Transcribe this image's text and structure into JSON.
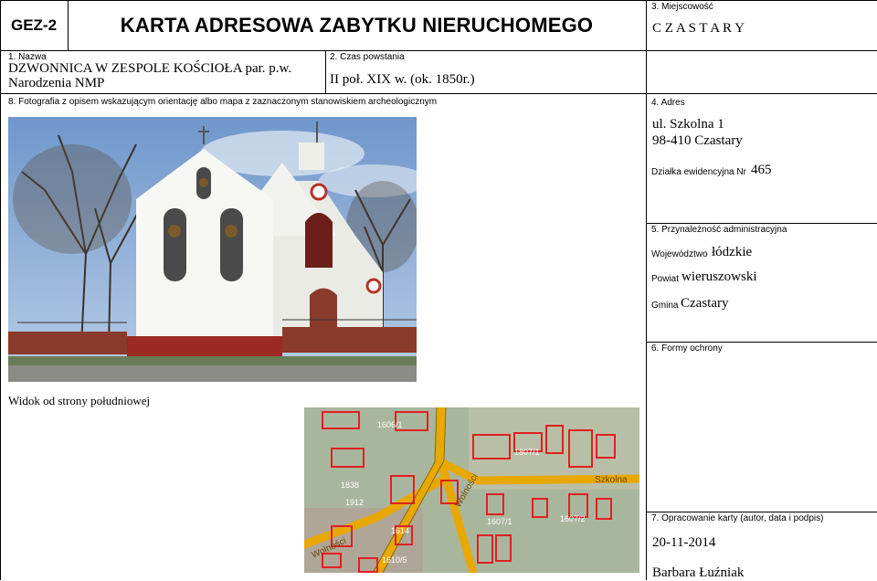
{
  "header": {
    "code": "GEZ-2",
    "title": "KARTA ADRESOWA ZABYTKU NIERUCHOMEGO"
  },
  "fields": {
    "nazwa": {
      "label": "1. Nazwa",
      "line1": "DZWONNICA W ZESPOLE KOŚCIOŁA par. p.w.",
      "line2": "Narodzenia NMP"
    },
    "czas": {
      "label": "2. Czas powstania",
      "value": "II poł. XIX w. (ok. 1850r.)"
    },
    "miejscowosc": {
      "label": "3. Miejscowość",
      "value": "C Z A S T A R Y"
    },
    "adres": {
      "label": "4. Adres",
      "street": "ul. Szkolna 1",
      "city": "98-410 Czastary",
      "dzialka_label": "Działka ewidencyjna Nr",
      "dzialka_value": "465"
    },
    "przynaleznosc": {
      "label": "5. Przynależność administracyjna",
      "woj_label": "Województwo",
      "woj_value": "łódzkie",
      "pow_label": "Powiat",
      "pow_value": "wieruszowski",
      "gmina_label": "Gmina",
      "gmina_value": "Czastary"
    },
    "formy": {
      "label": "6. Formy ochrony"
    },
    "opracowanie": {
      "label": "7. Opracowanie karty (autor, data i podpis)",
      "date": "20-11-2014",
      "author": "Barbara Łuźniak"
    },
    "foto": {
      "label": "8. Fotografia z opisem wskazującym orientację albo mapa z zaznaczonym stanowiskiem archeologicznym",
      "caption": "Widok od strony południowej"
    }
  },
  "map": {
    "street_labels": [
      "Wolności",
      "Szkolna",
      "Wolności"
    ],
    "parcel_labels": [
      "1606/1",
      "1807/1",
      "1912",
      "1607/1",
      "1607/2",
      "1614",
      "1610/5",
      "1838"
    ]
  },
  "colors": {
    "sky": "#8fb0d8",
    "church_wall": "#f4f4f0",
    "roof_red": "#b8332a",
    "road_yellow": "#e8a800",
    "map_bg": "#a8b8a0",
    "parcel_red": "#e02020"
  }
}
